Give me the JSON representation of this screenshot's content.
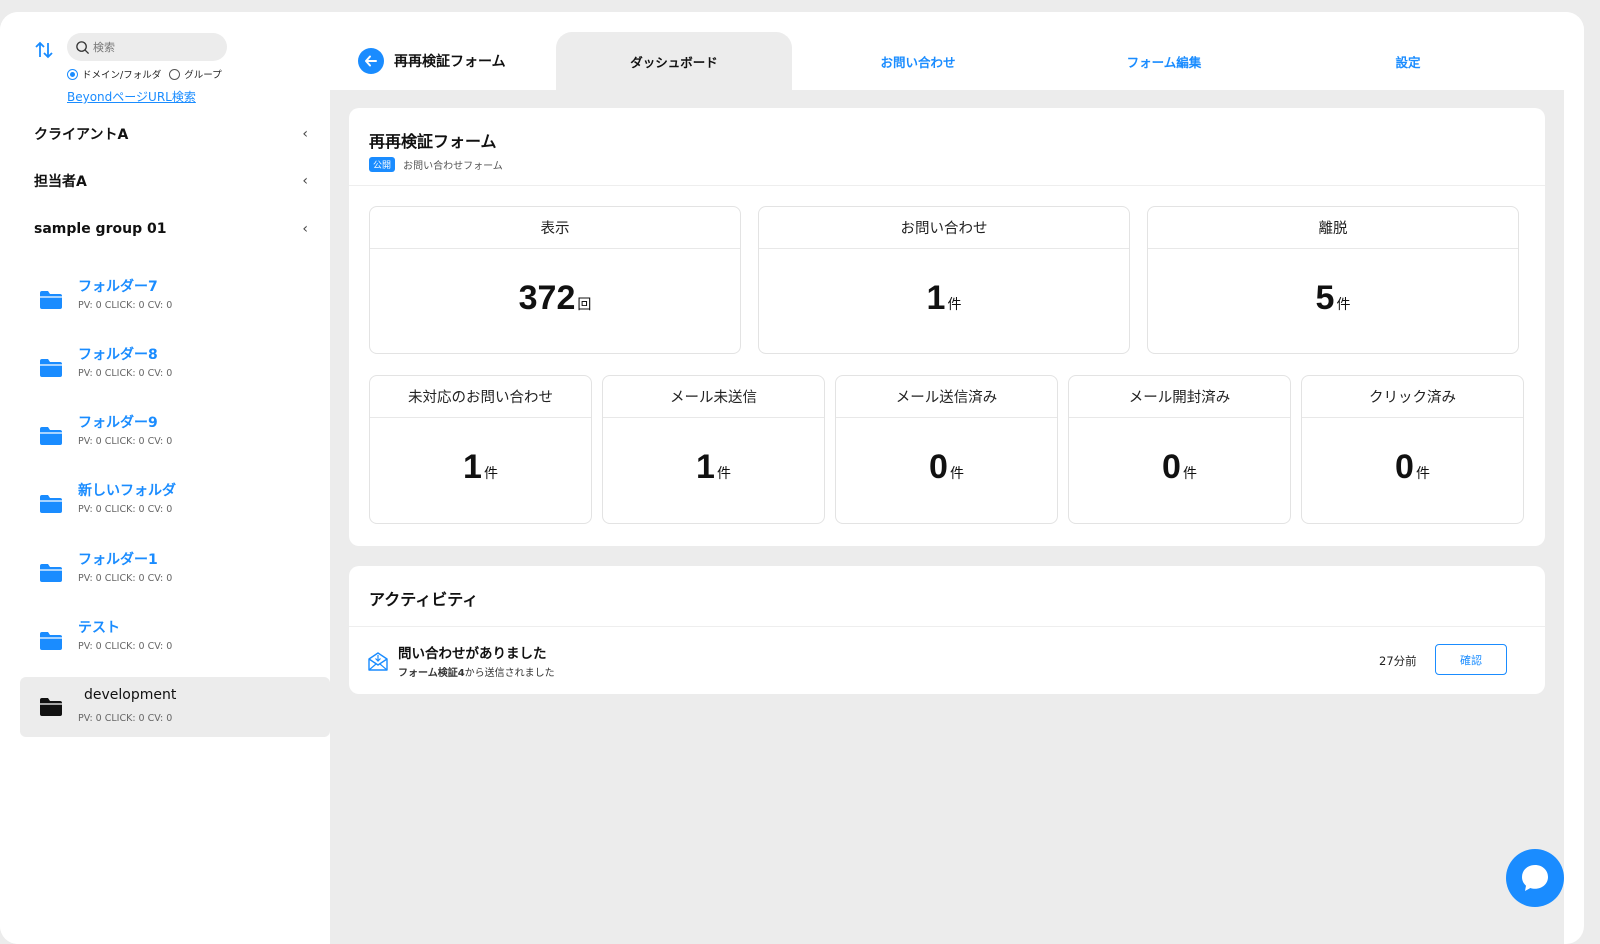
{
  "sidebar": {
    "search_placeholder": "検索",
    "radio_domain": "ドメイン/フォルダ",
    "radio_group": "グループ",
    "beyond_link": "BeyondページURL検索",
    "groups": [
      {
        "label": "クライアントA"
      },
      {
        "label": "担当者A"
      },
      {
        "label": "sample group 01"
      }
    ],
    "folders": [
      {
        "name": "フォルダー7",
        "stats": "PV: 0  CLICK: 0  CV: 0"
      },
      {
        "name": "フォルダー8",
        "stats": "PV: 0  CLICK: 0  CV: 0"
      },
      {
        "name": "フォルダー9",
        "stats": "PV: 0  CLICK: 0  CV: 0"
      },
      {
        "name": "新しいフォルダ",
        "stats": "PV: 0  CLICK: 0  CV: 0"
      },
      {
        "name": "フォルダー1",
        "stats": "PV: 0  CLICK: 0  CV: 0"
      },
      {
        "name": "テスト",
        "stats": "PV: 0  CLICK: 0  CV: 0"
      },
      {
        "name": "development",
        "stats": "PV: 0  CLICK: 0  CV: 0"
      }
    ]
  },
  "header": {
    "form_title": "再再検証フォーム",
    "tabs": [
      {
        "label": "ダッシュボード"
      },
      {
        "label": "お問い合わせ"
      },
      {
        "label": "フォーム編集"
      },
      {
        "label": "設定"
      }
    ]
  },
  "summary": {
    "title": "再再検証フォーム",
    "badge": "公開",
    "subtitle": "お問い合わせフォーム",
    "stats_top": [
      {
        "label": "表示",
        "value": "372",
        "unit": "回"
      },
      {
        "label": "お問い合わせ",
        "value": "1",
        "unit": "件"
      },
      {
        "label": "離脱",
        "value": "5",
        "unit": "件"
      }
    ],
    "stats_bottom": [
      {
        "label": "未対応のお問い合わせ",
        "value": "1",
        "unit": "件"
      },
      {
        "label": "メール未送信",
        "value": "1",
        "unit": "件"
      },
      {
        "label": "メール送信済み",
        "value": "0",
        "unit": "件"
      },
      {
        "label": "メール開封済み",
        "value": "0",
        "unit": "件"
      },
      {
        "label": "クリック済み",
        "value": "0",
        "unit": "件"
      }
    ]
  },
  "activity": {
    "title": "アクティビティ",
    "item": {
      "main": "問い合わせがありました",
      "source": "フォーム検証4",
      "source_suffix": "から送信されました",
      "time": "27分前",
      "button": "確認"
    }
  },
  "colors": {
    "accent": "#1a8cff",
    "background": "#ececec"
  }
}
